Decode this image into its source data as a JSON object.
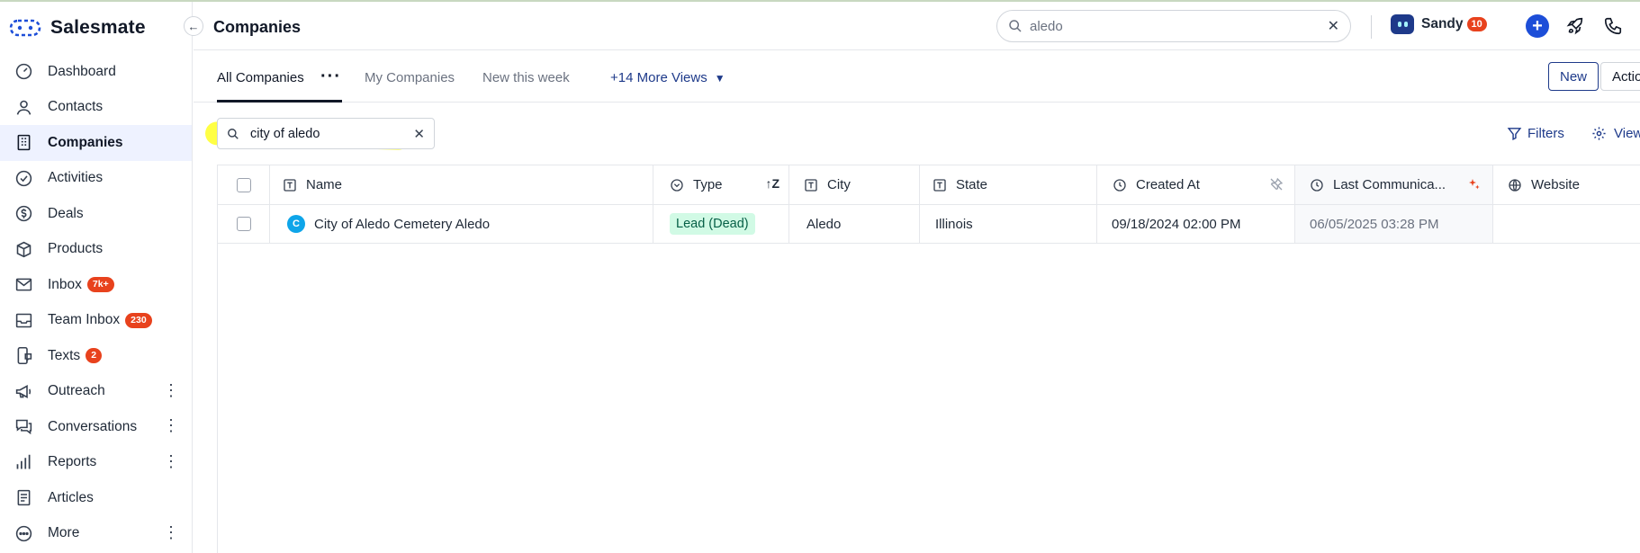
{
  "app": {
    "brand": "Salesmate"
  },
  "sidebar": {
    "items": [
      {
        "label": "Dashboard",
        "icon": "dashboard-icon"
      },
      {
        "label": "Contacts",
        "icon": "user-icon"
      },
      {
        "label": "Companies",
        "icon": "building-icon",
        "active": true
      },
      {
        "label": "Activities",
        "icon": "check-circle-icon"
      },
      {
        "label": "Deals",
        "icon": "dollar-icon"
      },
      {
        "label": "Products",
        "icon": "box-icon"
      },
      {
        "label": "Inbox",
        "icon": "mail-icon",
        "badge": "7k+"
      },
      {
        "label": "Team Inbox",
        "icon": "inbox-icon",
        "badge": "230"
      },
      {
        "label": "Texts",
        "icon": "sms-icon",
        "badge": "2"
      },
      {
        "label": "Outreach",
        "icon": "megaphone-icon"
      },
      {
        "label": "Conversations",
        "icon": "chat-icon"
      },
      {
        "label": "Reports",
        "icon": "bar-chart-icon"
      },
      {
        "label": "Articles",
        "icon": "article-icon"
      },
      {
        "label": "More",
        "icon": "more-circle-icon"
      }
    ]
  },
  "header": {
    "title": "Companies",
    "search_value": "aledo",
    "user_name": "Sandy",
    "user_badge": "10"
  },
  "views": {
    "tabs": [
      "All Companies",
      "My Companies",
      "New this week"
    ],
    "more_views": "+14 More Views",
    "new_button": "New",
    "actions_button": "Actions"
  },
  "filterbar": {
    "search_value": "city of aledo",
    "filters_label": "Filters",
    "view_label": "View"
  },
  "table": {
    "columns": [
      "Name",
      "Type",
      "City",
      "State",
      "Created At",
      "Last Communica...",
      "Website"
    ],
    "rows": [
      {
        "avatar": "C",
        "name": "City of Aledo Cemetery Aledo",
        "type": "Lead (Dead)",
        "city": "Aledo",
        "state": "Illinois",
        "created_at": "09/18/2024 02:00 PM",
        "last_communication": "06/05/2025 03:28 PM",
        "website": ""
      }
    ]
  },
  "colors": {
    "accent": "#1e3a8a",
    "badge": "#e8421d",
    "highlight": "#ffff3b",
    "type_badge_bg": "#d1fae5"
  }
}
